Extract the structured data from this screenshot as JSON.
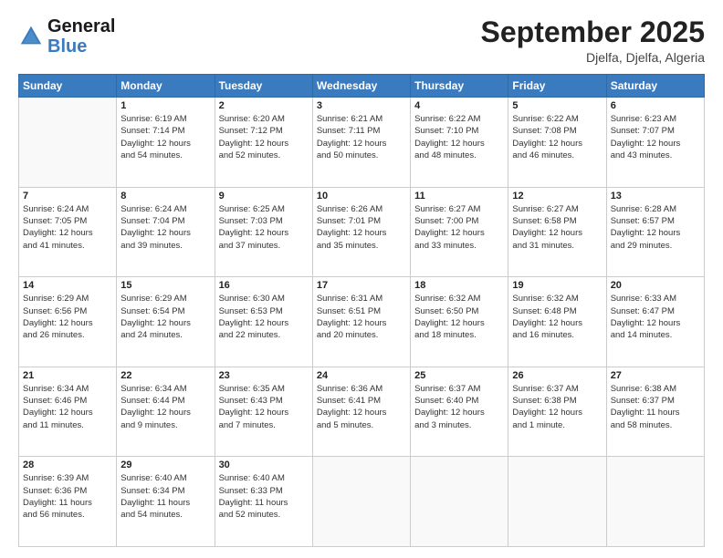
{
  "header": {
    "logo_general": "General",
    "logo_blue": "Blue",
    "month_title": "September 2025",
    "location": "Djelfa, Djelfa, Algeria"
  },
  "days_of_week": [
    "Sunday",
    "Monday",
    "Tuesday",
    "Wednesday",
    "Thursday",
    "Friday",
    "Saturday"
  ],
  "weeks": [
    [
      {
        "day": "",
        "info": ""
      },
      {
        "day": "1",
        "info": "Sunrise: 6:19 AM\nSunset: 7:14 PM\nDaylight: 12 hours\nand 54 minutes."
      },
      {
        "day": "2",
        "info": "Sunrise: 6:20 AM\nSunset: 7:12 PM\nDaylight: 12 hours\nand 52 minutes."
      },
      {
        "day": "3",
        "info": "Sunrise: 6:21 AM\nSunset: 7:11 PM\nDaylight: 12 hours\nand 50 minutes."
      },
      {
        "day": "4",
        "info": "Sunrise: 6:22 AM\nSunset: 7:10 PM\nDaylight: 12 hours\nand 48 minutes."
      },
      {
        "day": "5",
        "info": "Sunrise: 6:22 AM\nSunset: 7:08 PM\nDaylight: 12 hours\nand 46 minutes."
      },
      {
        "day": "6",
        "info": "Sunrise: 6:23 AM\nSunset: 7:07 PM\nDaylight: 12 hours\nand 43 minutes."
      }
    ],
    [
      {
        "day": "7",
        "info": "Sunrise: 6:24 AM\nSunset: 7:05 PM\nDaylight: 12 hours\nand 41 minutes."
      },
      {
        "day": "8",
        "info": "Sunrise: 6:24 AM\nSunset: 7:04 PM\nDaylight: 12 hours\nand 39 minutes."
      },
      {
        "day": "9",
        "info": "Sunrise: 6:25 AM\nSunset: 7:03 PM\nDaylight: 12 hours\nand 37 minutes."
      },
      {
        "day": "10",
        "info": "Sunrise: 6:26 AM\nSunset: 7:01 PM\nDaylight: 12 hours\nand 35 minutes."
      },
      {
        "day": "11",
        "info": "Sunrise: 6:27 AM\nSunset: 7:00 PM\nDaylight: 12 hours\nand 33 minutes."
      },
      {
        "day": "12",
        "info": "Sunrise: 6:27 AM\nSunset: 6:58 PM\nDaylight: 12 hours\nand 31 minutes."
      },
      {
        "day": "13",
        "info": "Sunrise: 6:28 AM\nSunset: 6:57 PM\nDaylight: 12 hours\nand 29 minutes."
      }
    ],
    [
      {
        "day": "14",
        "info": "Sunrise: 6:29 AM\nSunset: 6:56 PM\nDaylight: 12 hours\nand 26 minutes."
      },
      {
        "day": "15",
        "info": "Sunrise: 6:29 AM\nSunset: 6:54 PM\nDaylight: 12 hours\nand 24 minutes."
      },
      {
        "day": "16",
        "info": "Sunrise: 6:30 AM\nSunset: 6:53 PM\nDaylight: 12 hours\nand 22 minutes."
      },
      {
        "day": "17",
        "info": "Sunrise: 6:31 AM\nSunset: 6:51 PM\nDaylight: 12 hours\nand 20 minutes."
      },
      {
        "day": "18",
        "info": "Sunrise: 6:32 AM\nSunset: 6:50 PM\nDaylight: 12 hours\nand 18 minutes."
      },
      {
        "day": "19",
        "info": "Sunrise: 6:32 AM\nSunset: 6:48 PM\nDaylight: 12 hours\nand 16 minutes."
      },
      {
        "day": "20",
        "info": "Sunrise: 6:33 AM\nSunset: 6:47 PM\nDaylight: 12 hours\nand 14 minutes."
      }
    ],
    [
      {
        "day": "21",
        "info": "Sunrise: 6:34 AM\nSunset: 6:46 PM\nDaylight: 12 hours\nand 11 minutes."
      },
      {
        "day": "22",
        "info": "Sunrise: 6:34 AM\nSunset: 6:44 PM\nDaylight: 12 hours\nand 9 minutes."
      },
      {
        "day": "23",
        "info": "Sunrise: 6:35 AM\nSunset: 6:43 PM\nDaylight: 12 hours\nand 7 minutes."
      },
      {
        "day": "24",
        "info": "Sunrise: 6:36 AM\nSunset: 6:41 PM\nDaylight: 12 hours\nand 5 minutes."
      },
      {
        "day": "25",
        "info": "Sunrise: 6:37 AM\nSunset: 6:40 PM\nDaylight: 12 hours\nand 3 minutes."
      },
      {
        "day": "26",
        "info": "Sunrise: 6:37 AM\nSunset: 6:38 PM\nDaylight: 12 hours\nand 1 minute."
      },
      {
        "day": "27",
        "info": "Sunrise: 6:38 AM\nSunset: 6:37 PM\nDaylight: 11 hours\nand 58 minutes."
      }
    ],
    [
      {
        "day": "28",
        "info": "Sunrise: 6:39 AM\nSunset: 6:36 PM\nDaylight: 11 hours\nand 56 minutes."
      },
      {
        "day": "29",
        "info": "Sunrise: 6:40 AM\nSunset: 6:34 PM\nDaylight: 11 hours\nand 54 minutes."
      },
      {
        "day": "30",
        "info": "Sunrise: 6:40 AM\nSunset: 6:33 PM\nDaylight: 11 hours\nand 52 minutes."
      },
      {
        "day": "",
        "info": ""
      },
      {
        "day": "",
        "info": ""
      },
      {
        "day": "",
        "info": ""
      },
      {
        "day": "",
        "info": ""
      }
    ]
  ]
}
